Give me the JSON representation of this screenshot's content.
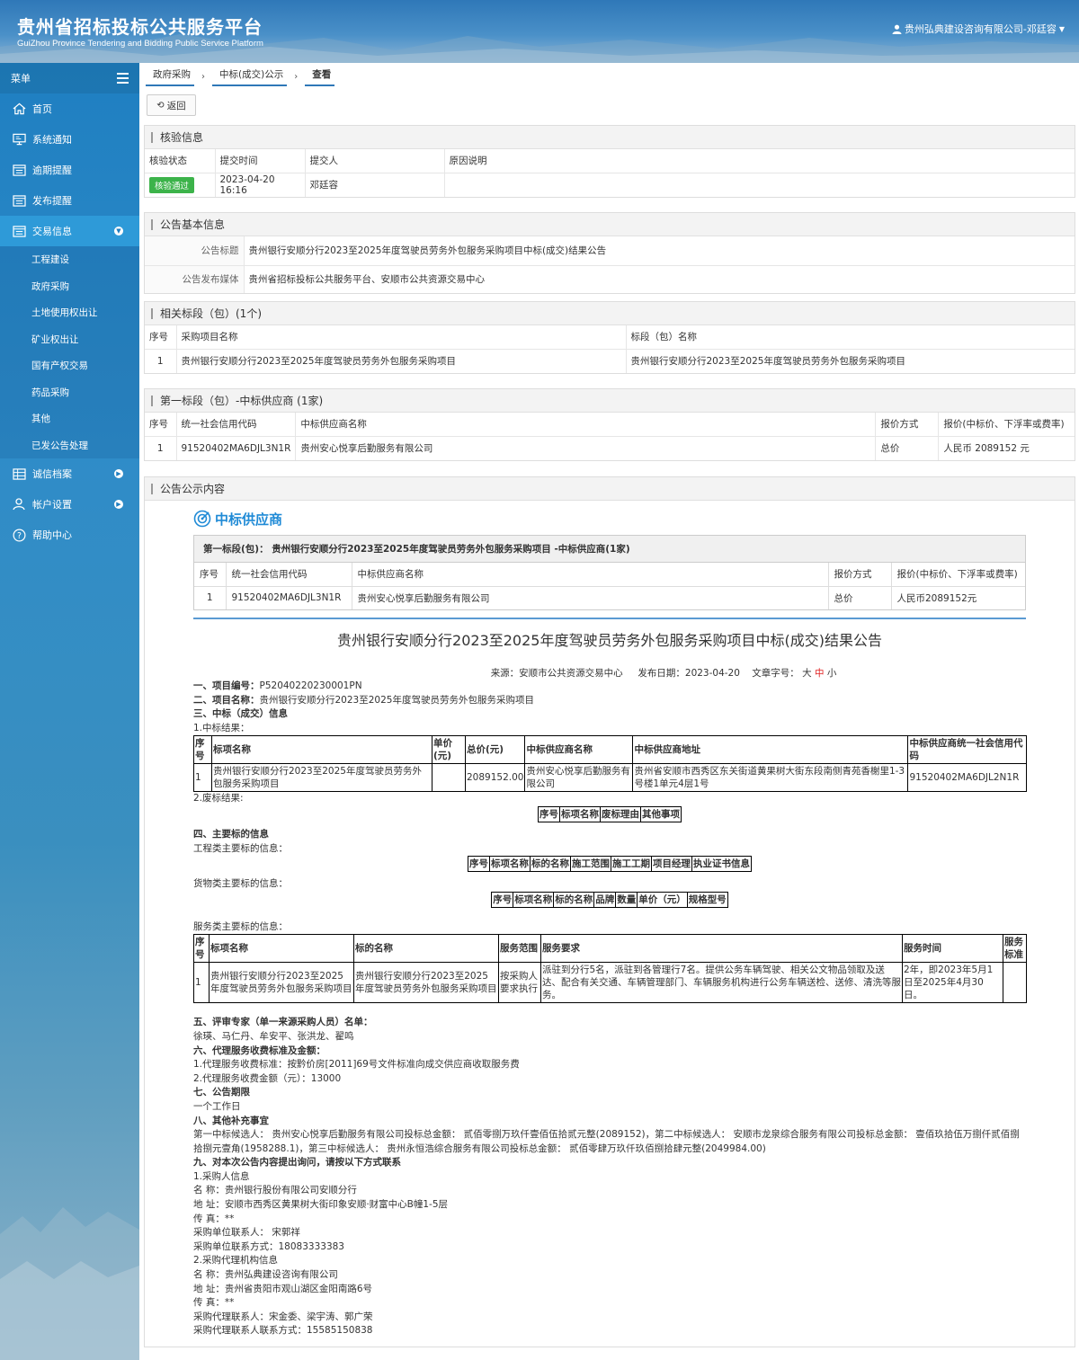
{
  "header": {
    "title_cn": "贵州省招标投标公共服务平台",
    "title_en": "GuiZhou Province Tendering and Bidding Public Service Platform",
    "user": "贵州弘典建设咨询有限公司-邓廷容"
  },
  "sidebar": {
    "menu_label": "菜单",
    "items": [
      {
        "label": "首页",
        "icon": "home-icon"
      },
      {
        "label": "系统通知",
        "icon": "monitor-icon"
      },
      {
        "label": "逾期提醒",
        "icon": "list-icon"
      },
      {
        "label": "发布提醒",
        "icon": "list-icon"
      },
      {
        "label": "交易信息",
        "icon": "list-icon"
      },
      {
        "label": "诚信档案",
        "icon": "table-icon"
      },
      {
        "label": "帐户设置",
        "icon": "user-icon"
      },
      {
        "label": "帮助中心",
        "icon": "help-icon"
      }
    ],
    "subitems": [
      "工程建设",
      "政府采购",
      "土地使用权出让",
      "矿业权出让",
      "国有产权交易",
      "药品采购",
      "其他",
      "已发公告处理"
    ]
  },
  "breadcrumb": [
    "政府采购",
    "中标(成交)公示",
    "查看"
  ],
  "back_label": "返回",
  "verify": {
    "title": "核验信息",
    "headers": [
      "核验状态",
      "提交时间",
      "提交人",
      "原因说明"
    ],
    "status": "核验通过",
    "time": "2023-04-20 16:16",
    "person": "邓廷容",
    "reason": ""
  },
  "basic": {
    "title": "公告基本信息",
    "rows": [
      {
        "k": "公告标题",
        "v": "贵州银行安顺分行2023至2025年度驾驶员劳务外包服务采购项目中标(成交)结果公告"
      },
      {
        "k": "公告发布媒体",
        "v": "贵州省招标投标公共服务平台、安顺市公共资源交易中心"
      }
    ]
  },
  "sections": {
    "title": "相关标段（包）(1个)",
    "headers": [
      "序号",
      "采购项目名称",
      "标段（包）名称"
    ],
    "row": [
      "1",
      "贵州银行安顺分行2023至2025年度驾驶员劳务外包服务采购项目",
      "贵州银行安顺分行2023至2025年度驾驶员劳务外包服务采购项目"
    ]
  },
  "winner": {
    "title": "第一标段（包）-中标供应商 (1家)",
    "headers": [
      "序号",
      "统一社会信用代码",
      "中标供应商名称",
      "报价方式",
      "报价(中标价、下浮率或费率)"
    ],
    "row": [
      "1",
      "91520402MA6DJL3N1R",
      "贵州安心悦享后勤服务有限公司",
      "总价",
      "人民币 2089152 元"
    ]
  },
  "content": {
    "title": "公告公示内容",
    "zbs_label": "中标供应商",
    "zbs_head": "第一标段(包)： 贵州银行安顺分行2023至2025年度驾驶员劳务外包服务采购项目 -中标供应商(1家)",
    "zbs_headers": [
      "序号",
      "统一社会信用代码",
      "中标供应商名称",
      "报价方式",
      "报价(中标价、下浮率或费率)"
    ],
    "zbs_row": [
      "1",
      "91520402MA6DJL3N1R",
      "贵州安心悦享后勤服务有限公司",
      "总价",
      "人民币2089152元"
    ],
    "doc_title": "贵州银行安顺分行2023至2025年度驾驶员劳务外包服务采购项目中标(成交)结果公告",
    "meta_source": "来源：安顺市公共资源交易中心",
    "meta_date": "发布日期：2023-04-20",
    "meta_size_label": "文章字号：",
    "meta_big": "大",
    "meta_mid": "中",
    "meta_small": "小",
    "s1_label": "一、项目编号：",
    "s1_value": "P52040220230001PN",
    "s2_label": "二、项目名称：",
    "s2_value": "贵州银行安顺分行2023至2025年度驾驶员劳务外包服务采购项目",
    "s3": "三、中标（成交）信息",
    "s3_1": "1.中标结果：",
    "result_headers": [
      "序号",
      "标项名称",
      "单价(元)",
      "总价(元)",
      "中标供应商名称",
      "中标供应商地址",
      "中标供应商统一社会信用代码"
    ],
    "result_row": [
      "1",
      "贵州银行安顺分行2023至2025年度驾驶员劳务外包服务采购项目",
      "",
      "2089152.00",
      "贵州安心悦享后勤服务有限公司",
      "贵州省安顺市西秀区东关街道黄果树大街东段南侧青苑香榭里1-3号楼1单元4层1号",
      "91520402MA6DJL2N1R"
    ],
    "s3_2": "2.废标结果:",
    "fail_headers": [
      "序号",
      "标项名称",
      "废标理由",
      "其他事项"
    ],
    "s4": "四、主要标的信息",
    "s4_eng": "工程类主要标的信息：",
    "eng_headers": [
      "序号",
      "标项名称",
      "标的名称",
      "施工范围",
      "施工工期",
      "项目经理",
      "执业证书信息"
    ],
    "s4_goods": "货物类主要标的信息：",
    "goods_headers": [
      "序号",
      "标项名称",
      "标的名称",
      "品牌",
      "数量",
      "单价（元）",
      "规格型号"
    ],
    "s4_svc": "服务类主要标的信息：",
    "svc_headers": [
      "序号",
      "标项名称",
      "标的名称",
      "服务范围",
      "服务要求",
      "服务时间",
      "服务标准"
    ],
    "svc_row": [
      "1",
      "贵州银行安顺分行2023至2025年度驾驶员劳务外包服务采购项目",
      "贵州银行安顺分行2023至2025年度驾驶员劳务外包服务采购项目",
      "按采购人要求执行",
      "派驻到分行5名，派驻到各管理行7名。提供公务车辆驾驶、相关公文物品领取及送达、配合有关交通、车辆管理部门、车辆服务机构进行公务车辆送检、送修、清洗等服务。",
      "2年，即2023年5月1日至2025年4月30日。",
      ""
    ],
    "s5": "五、评审专家（单一来源采购人员）名单：",
    "s5_v": "徐瑛、马仁丹、牟安平、张洪龙、翟鸣",
    "s6": "六、代理服务收费标准及金额：",
    "s6_1": "1.代理服务收费标准：按黔价房[2011]69号文件标准向成交供应商收取服务费",
    "s6_2": "2.代理服务收费金额（元）：13000",
    "s7": "七、公告期限",
    "s7_v": "一个工作日",
    "s8": "八、其他补充事宜",
    "s8_v": "第一中标候选人： 贵州安心悦享后勤服务有限公司投标总金额： 贰佰零捌万玖仟壹佰伍拾贰元整(2089152)，第二中标候选人： 安顺市龙泉综合服务有限公司投标总金额： 壹佰玖拾伍万捌仟贰佰捌拾捌元壹角(1958288.1)，第三中标候选人： 贵州永恒浩综合服务有限公司投标总金额： 贰佰零肆万玖仟玖佰捌拾肆元整(2049984.00)",
    "s9": "九、对本次公告内容提出询问，请按以下方式联系",
    "c1": "1.采购人信息",
    "c1_name": "名 称：贵州银行股份有限公司安顺分行",
    "c1_addr": "地 址：安顺市西秀区黄果树大街印象安顺·财富中心B幢1-5层",
    "c1_fax": "传 真：**",
    "c1_contact": "采购单位联系人： 宋郭祥",
    "c1_phone": "采购单位联系方式：18083333383",
    "c2": "2.采购代理机构信息",
    "c2_name": "名 称：贵州弘典建设咨询有限公司",
    "c2_addr": "地 址：贵州省贵阳市观山湖区金阳南路6号",
    "c2_fax": "传 真：**",
    "c2_contact": "采购代理联系人：宋金委、梁宇涛、郭广荣",
    "c2_phone": "采购代理联系人联系方式：15585150838"
  },
  "colors": {
    "header": "#2f78b8",
    "sidebar": "#1f7fc1",
    "active": "#2e9ad8",
    "badge": "#3cb34a",
    "accent": "#1f8ad6"
  }
}
